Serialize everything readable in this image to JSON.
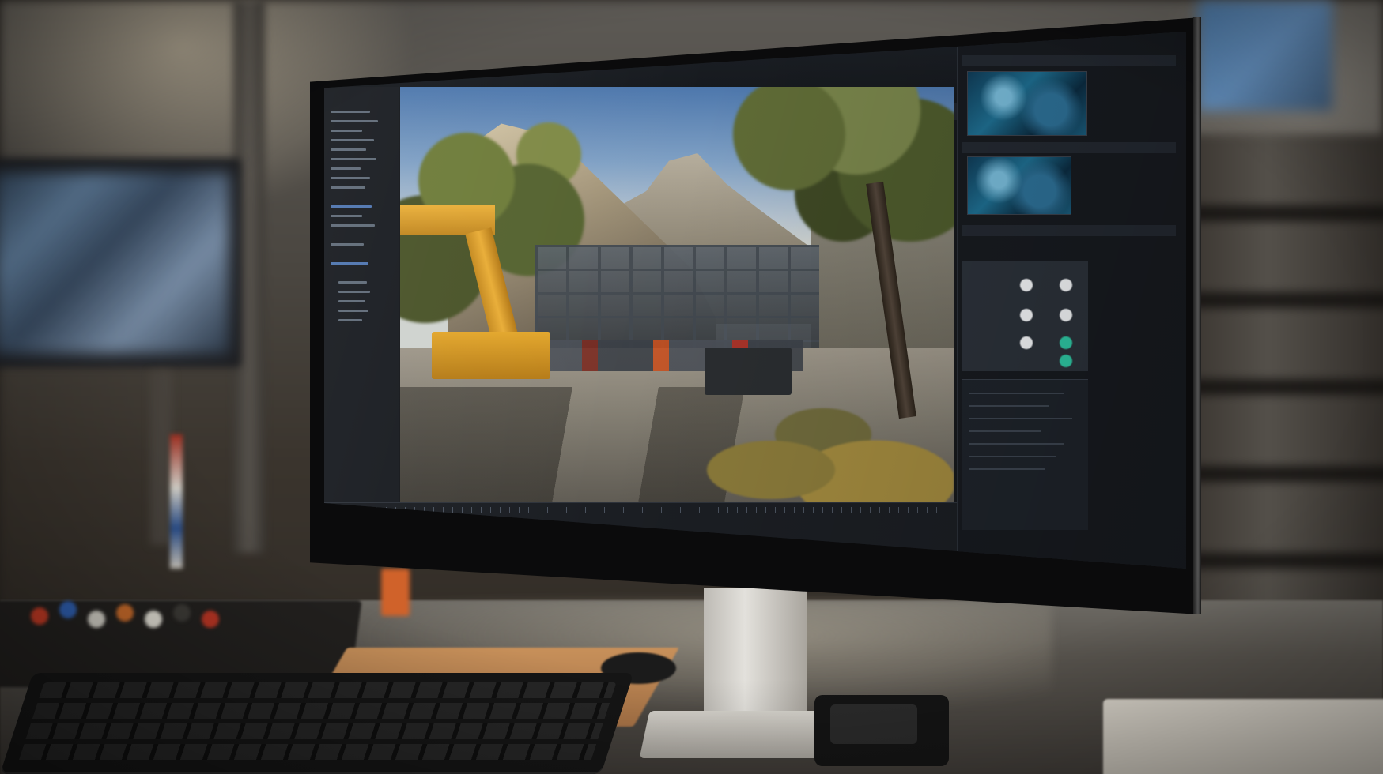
{
  "scene": {
    "description_colors": {
      "accent_blue": "#5b86c9",
      "crane_yellow": "#e3a72c",
      "asset_green": "#2ec6a2",
      "editor_bg": "#16181c"
    },
    "objects": [
      "monitor",
      "game-engine-editor",
      "keyboard",
      "desk",
      "background-monitor",
      "shelf"
    ]
  }
}
